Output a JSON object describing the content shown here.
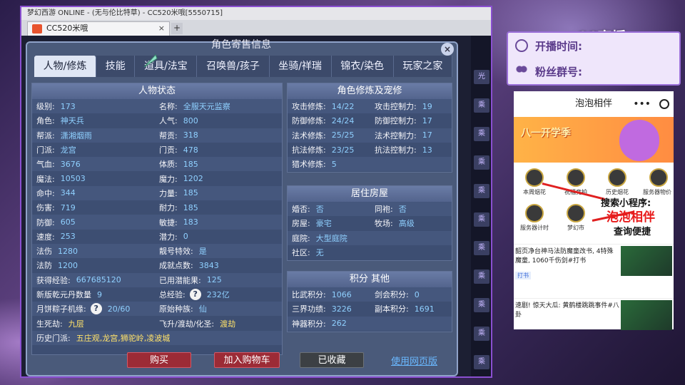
{
  "browser": {
    "title_bar": "梦幻西游 ONLINE - (无与伦比特草) - CC520米哦[5550715]",
    "tab_label": "CC520米哦",
    "tab_close": "×",
    "tab_new": "+"
  },
  "dialog": {
    "title": "角色寄售信息",
    "close": "×",
    "tabs": [
      "人物/修炼",
      "技能",
      "道具/法宝",
      "召唤兽/孩子",
      "坐骑/祥瑞",
      "锦衣/染色",
      "玩家之家"
    ]
  },
  "side_chips": [
    "光",
    "乘",
    "乘",
    "乘",
    "乘",
    "乘",
    "乘",
    "乘",
    "乘",
    "乘",
    "乘"
  ],
  "char_status": {
    "header": "人物状态",
    "rows": [
      {
        "l1": "级别:",
        "v1": "173",
        "l2": "名称:",
        "v2": "全服天元监察"
      },
      {
        "l1": "角色:",
        "v1": "神天兵",
        "l2": "人气:",
        "v2": "800"
      },
      {
        "l1": "帮派:",
        "v1": "潇湘烟雨",
        "l2": "帮贡:",
        "v2": "318"
      },
      {
        "l1": "门派:",
        "v1": "龙宫",
        "l2": "门贡:",
        "v2": "478"
      },
      {
        "l1": "气血:",
        "v1": "3676",
        "l2": "体质:",
        "v2": "185"
      },
      {
        "l1": "魔法:",
        "v1": "10503",
        "l2": "魔力:",
        "v2": "1202"
      },
      {
        "l1": "命中:",
        "v1": "344",
        "l2": "力量:",
        "v2": "185"
      },
      {
        "l1": "伤害:",
        "v1": "719",
        "l2": "耐力:",
        "v2": "185"
      },
      {
        "l1": "防御:",
        "v1": "605",
        "l2": "敏捷:",
        "v2": "183"
      },
      {
        "l1": "速度:",
        "v1": "253",
        "l2": "潜力:",
        "v2": "0"
      },
      {
        "l1": "法伤",
        "v1": "1280",
        "l2": "靓号特效:",
        "v2": "是"
      },
      {
        "l1": "法防",
        "v1": "1200",
        "l2": "成就点数:",
        "v2": "3843"
      },
      {
        "l1": "获得经验:",
        "v1": "667685120",
        "l2": "已用潜能果:",
        "v2": "125"
      },
      {
        "l1": "新版乾元丹数量",
        "v1": "9",
        "l2": "总经验:",
        "v2": "232亿"
      },
      {
        "l1": "月饼粽子机缘:",
        "v1": "20/60",
        "l2": "原始种族:",
        "v2": "仙"
      },
      {
        "l1": "生死劫:",
        "v1": "九层",
        "l2": "飞升/渡劫/化圣:",
        "v2": "渡劫"
      },
      {
        "l1": "历史门派:",
        "v1": "五庄观,龙宫,狮驼岭,凌波城",
        "l2": "",
        "v2": ""
      }
    ]
  },
  "cultivation": {
    "header": "角色修炼及宠修",
    "rows": [
      {
        "l1": "攻击修炼:",
        "v1": "14/22",
        "l2": "攻击控制力:",
        "v2": "19"
      },
      {
        "l1": "防御修炼:",
        "v1": "24/24",
        "l2": "防御控制力:",
        "v2": "17"
      },
      {
        "l1": "法术修炼:",
        "v1": "25/25",
        "l2": "法术控制力:",
        "v2": "17"
      },
      {
        "l1": "抗法修炼:",
        "v1": "23/25",
        "l2": "抗法控制力:",
        "v2": "13"
      },
      {
        "l1": "猎术修炼:",
        "v1": "5",
        "l2": "",
        "v2": ""
      }
    ]
  },
  "residence": {
    "header": "居住房屋",
    "rows": [
      {
        "l1": "婚否:",
        "v1": "否",
        "l2": "同袍:",
        "v2": "否"
      },
      {
        "l1": "房屋:",
        "v1": "豪宅",
        "l2": "牧场:",
        "v2": "高级"
      },
      {
        "l1": "庭院:",
        "v1": "大型庭院",
        "l2": "",
        "v2": ""
      },
      {
        "l1": "社区:",
        "v1": "无",
        "l2": "",
        "v2": ""
      }
    ]
  },
  "points": {
    "header": "积分 其他",
    "rows": [
      {
        "l1": "比武积分:",
        "v1": "1066",
        "l2": "剑会积分:",
        "v2": "0"
      },
      {
        "l1": "三界功绩:",
        "v1": "3226",
        "l2": "副本积分:",
        "v2": "1691"
      },
      {
        "l1": "神器积分:",
        "v1": "262",
        "l2": "",
        "v2": ""
      }
    ]
  },
  "buttons": {
    "buy": "购买",
    "add_cart": "加入购物车",
    "collected": "已收藏",
    "web_version": "使用网页版"
  },
  "overlay": {
    "start_time_label": "开播时间:",
    "fan_group_label": "粉丝群号:",
    "cc_logo": "CC直播"
  },
  "phone": {
    "title": "泡泡相伴",
    "dots": "•••",
    "banner_text": "八一开学季",
    "grid": [
      "本周烟花",
      "祝福竞拍",
      "历史烟花",
      "服务器物价",
      "服务器计时",
      "梦幻市"
    ],
    "promo1": "搜索小程序:",
    "promo2": "泡泡相伴",
    "promo3": "查询便捷",
    "news": [
      {
        "text": "韶页净台神马法防魔童改书, 4特殊魔童, 1060千伤剑#打书",
        "chip": "打书"
      },
      {
        "text": "速剧! 惊天大瓜: 黄鹤楼跳跳事件#八卦",
        "chip": "八卦"
      }
    ]
  }
}
